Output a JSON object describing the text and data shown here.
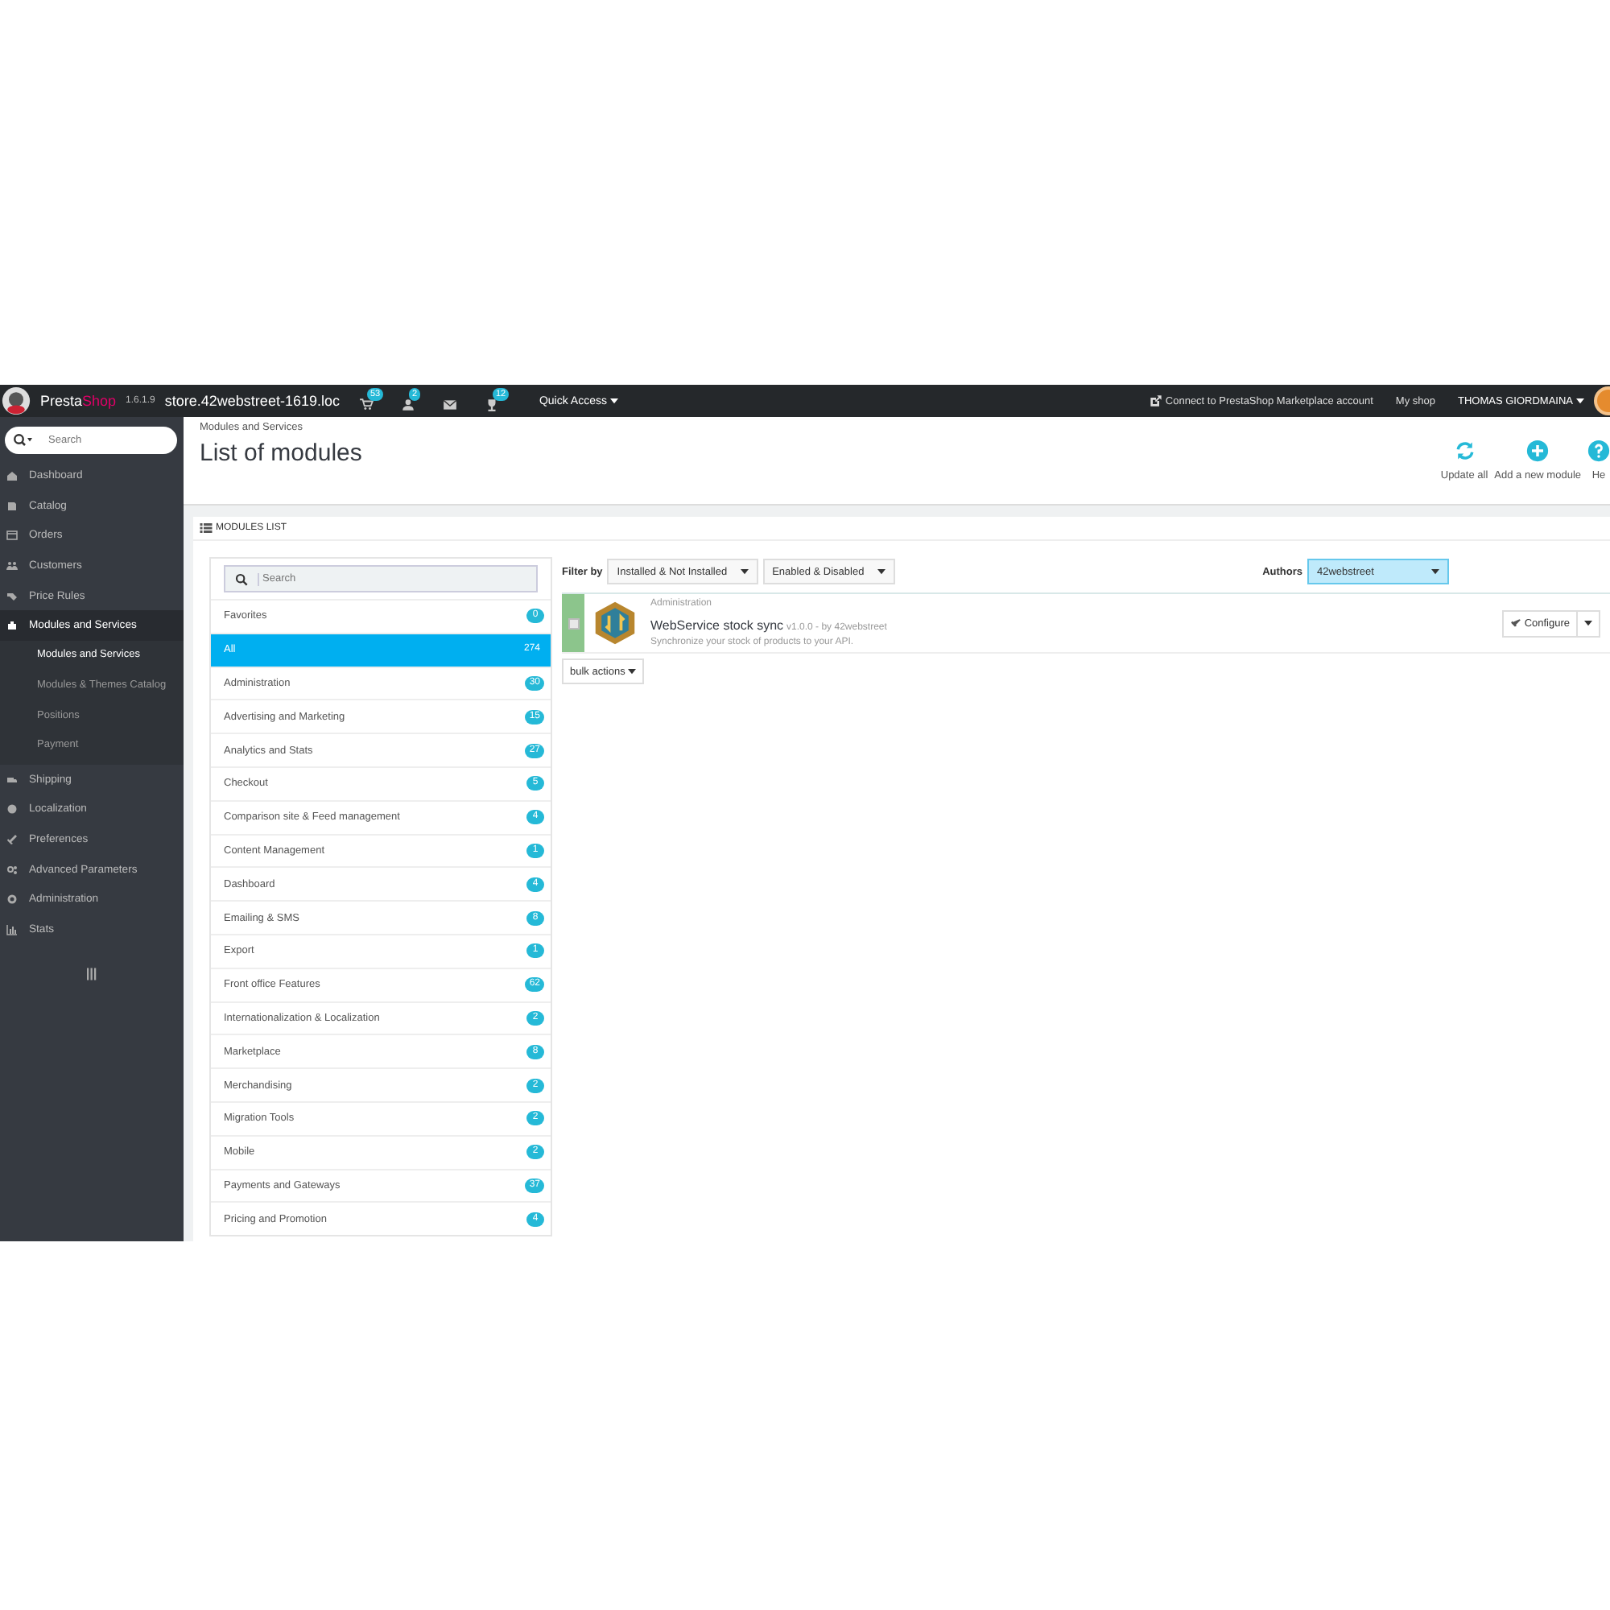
{
  "topbar": {
    "brand_parts": [
      "Presta",
      "Shop"
    ],
    "version": "1.6.1.9",
    "store": "store.42webstreet-1619.loc",
    "notifications": [
      {
        "kind": "cart",
        "count": "53"
      },
      {
        "kind": "person",
        "count": "2"
      },
      {
        "kind": "mail"
      },
      {
        "kind": "trophy",
        "count": "12"
      }
    ],
    "quick_access": "Quick Access",
    "connect": "Connect to PrestaShop Marketplace account",
    "my_shop": "My shop",
    "user": "THOMAS GIORDMAINA"
  },
  "sidebar": {
    "search_placeholder": "Search",
    "items": [
      {
        "label": "Dashboard",
        "selected": false
      },
      {
        "label": "Catalog",
        "selected": false
      },
      {
        "label": "Orders",
        "selected": false
      },
      {
        "label": "Customers",
        "selected": false
      },
      {
        "label": "Price Rules",
        "selected": false
      },
      {
        "label": "Modules and Services",
        "selected": true,
        "children": [
          {
            "label": "Modules and Services",
            "selected": true
          },
          {
            "label": "Modules & Themes Catalog",
            "selected": false
          },
          {
            "label": "Positions",
            "selected": false
          },
          {
            "label": "Payment",
            "selected": false
          }
        ]
      },
      {
        "label": "Shipping",
        "selected": false
      },
      {
        "label": "Localization",
        "selected": false
      },
      {
        "label": "Preferences",
        "selected": false
      },
      {
        "label": "Advanced Parameters",
        "selected": false
      },
      {
        "label": "Administration",
        "selected": false
      },
      {
        "label": "Stats",
        "selected": false
      }
    ]
  },
  "header": {
    "breadcrumb": "Modules and Services",
    "title": "List of modules",
    "toolbar": [
      {
        "kind": "refresh",
        "label": "Update all"
      },
      {
        "kind": "add",
        "label": "Add a new module"
      },
      {
        "kind": "help",
        "label": "He"
      }
    ]
  },
  "panel": {
    "heading": "MODULES LIST",
    "search_placeholder": "Search",
    "categories": [
      {
        "label": "Favorites",
        "count": "0",
        "selected": false
      },
      {
        "label": "All",
        "count": "274",
        "selected": true
      },
      {
        "label": "Administration",
        "count": "30",
        "selected": false
      },
      {
        "label": "Advertising and Marketing",
        "count": "15",
        "selected": false
      },
      {
        "label": "Analytics and Stats",
        "count": "27",
        "selected": false
      },
      {
        "label": "Checkout",
        "count": "5",
        "selected": false
      },
      {
        "label": "Comparison site & Feed management",
        "count": "4",
        "selected": false
      },
      {
        "label": "Content Management",
        "count": "1",
        "selected": false
      },
      {
        "label": "Dashboard",
        "count": "4",
        "selected": false
      },
      {
        "label": "Emailing & SMS",
        "count": "8",
        "selected": false
      },
      {
        "label": "Export",
        "count": "1",
        "selected": false
      },
      {
        "label": "Front office Features",
        "count": "62",
        "selected": false
      },
      {
        "label": "Internationalization & Localization",
        "count": "2",
        "selected": false
      },
      {
        "label": "Marketplace",
        "count": "8",
        "selected": false
      },
      {
        "label": "Merchandising",
        "count": "2",
        "selected": false
      },
      {
        "label": "Migration Tools",
        "count": "2",
        "selected": false
      },
      {
        "label": "Mobile",
        "count": "2",
        "selected": false
      },
      {
        "label": "Payments and Gateways",
        "count": "37",
        "selected": false
      },
      {
        "label": "Pricing and Promotion",
        "count": "4",
        "selected": false
      }
    ],
    "filter_label": "Filter by",
    "filters": [
      "Installed & Not Installed",
      "Enabled & Disabled"
    ],
    "authors_label": "Authors",
    "authors_value": "42webstreet",
    "modules": [
      {
        "category": "Administration",
        "name": "WebService stock sync",
        "version": "v1.0.0 - by 42webstreet",
        "description": "Synchronize your stock of products to your API.",
        "checked": false,
        "action": "Configure"
      }
    ],
    "bulk_actions": "bulk actions"
  }
}
